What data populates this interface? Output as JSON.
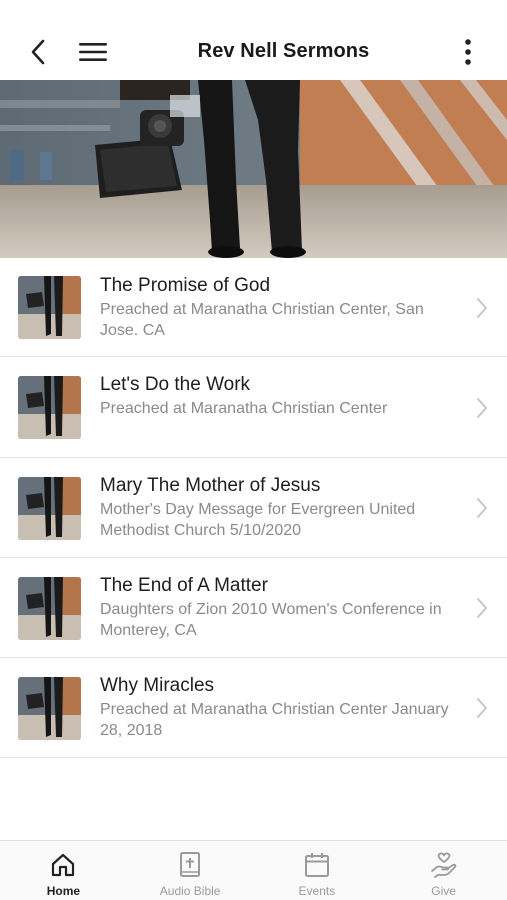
{
  "header": {
    "title": "Rev Nell Sermons"
  },
  "sermons": [
    {
      "title": "The Promise of God",
      "subtitle": "Preached at Maranatha Christian Center, San Jose. CA"
    },
    {
      "title": "Let's Do the Work",
      "subtitle": "Preached at Maranatha Christian Center"
    },
    {
      "title": "Mary The Mother of Jesus",
      "subtitle": "Mother's Day Message for Evergreen United Methodist Church 5/10/2020"
    },
    {
      "title": "The End of A Matter",
      "subtitle": "Daughters of Zion 2010 Women's Conference in Monterey, CA"
    },
    {
      "title": "Why Miracles",
      "subtitle": "Preached at Maranatha Christian Center January 28, 2018"
    }
  ],
  "tabs": [
    {
      "label": "Home",
      "icon": "home-icon",
      "active": true
    },
    {
      "label": "Audio Bible",
      "icon": "bible-icon",
      "active": false
    },
    {
      "label": "Events",
      "icon": "calendar-icon",
      "active": false
    },
    {
      "label": "Give",
      "icon": "give-hand-heart-icon",
      "active": false
    }
  ]
}
